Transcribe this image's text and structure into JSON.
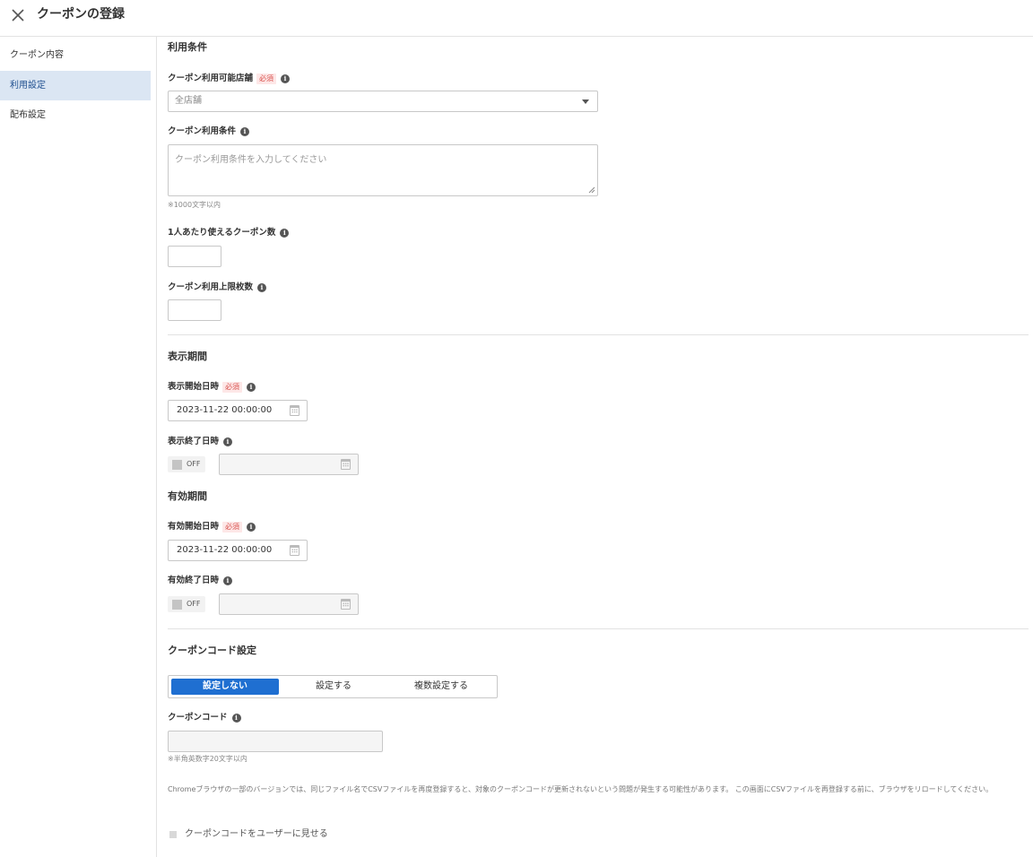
{
  "header": {
    "title": "クーポンの登録",
    "close_icon": "close-icon"
  },
  "sidebar": {
    "items": [
      {
        "label": "クーポン内容",
        "active": false
      },
      {
        "label": "利用設定",
        "active": true
      },
      {
        "label": "配布設定",
        "active": false
      }
    ]
  },
  "usage": {
    "title": "利用条件",
    "store": {
      "label": "クーポン利用可能店舗",
      "required": "必須",
      "value": "全店舗"
    },
    "conditions": {
      "label": "クーポン利用条件",
      "placeholder": "クーポン利用条件を入力してください",
      "hint": "※1000文字以内"
    },
    "per_user": {
      "label": "1人あたり使えるクーポン数",
      "value": ""
    },
    "limit": {
      "label": "クーポン利用上限枚数",
      "value": ""
    }
  },
  "display_period": {
    "title": "表示期間",
    "start": {
      "label": "表示開始日時",
      "required": "必須",
      "value": "2023-11-22 00:00:00"
    },
    "end": {
      "label": "表示終了日時",
      "toggle": "OFF",
      "value": ""
    }
  },
  "valid_period": {
    "title": "有効期間",
    "start": {
      "label": "有効開始日時",
      "required": "必須",
      "value": "2023-11-22 00:00:00"
    },
    "end": {
      "label": "有効終了日時",
      "toggle": "OFF",
      "value": ""
    }
  },
  "code_settings": {
    "title": "クーポンコード設定",
    "options": [
      "設定しない",
      "設定する",
      "複数設定する"
    ],
    "selected": "設定しない",
    "code": {
      "label": "クーポンコード",
      "value": "",
      "hint": "※半角英数字20文字以内"
    },
    "note": "Chromeブラウザの一部のバージョンでは、同じファイル名でCSVファイルを再度登録すると、対象のクーポンコードが更新されないという問題が発生する可能性があります。 この画面にCSVファイルを再登録する前に、ブラウザをリロードしてください。",
    "show_to_user": {
      "label": "クーポンコードをユーザーに見せる",
      "checked": false
    }
  }
}
